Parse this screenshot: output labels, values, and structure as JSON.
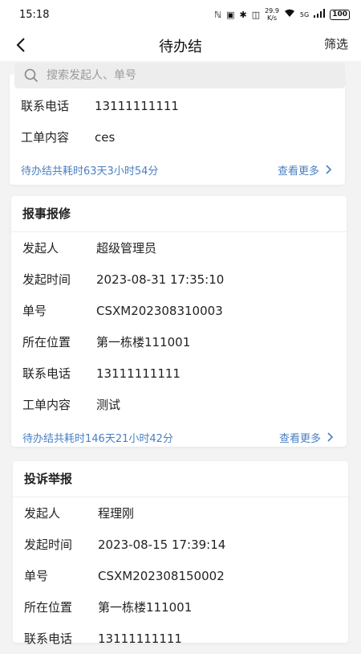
{
  "status_bar": {
    "time": "15:18",
    "net_speed_value": "29.9",
    "net_speed_unit": "K/s",
    "signal": "5G",
    "battery": "100"
  },
  "nav": {
    "title": "待办结",
    "filter_label": "筛选"
  },
  "search": {
    "placeholder": "搜索发起人、单号"
  },
  "colors": {
    "accent": "#4a7fc1",
    "background": "#f3f3f3"
  },
  "cards": [
    {
      "rows": [
        {
          "label": "联系电话",
          "value": "13111111111"
        },
        {
          "label": "工单内容",
          "value": "ces"
        }
      ],
      "elapsed": "待办结共耗时63天3小时54分",
      "more_label": "查看更多"
    },
    {
      "title": "报事报修",
      "rows": [
        {
          "label": "发起人",
          "value": "超级管理员"
        },
        {
          "label": "发起时间",
          "value": "2023-08-31 17:35:10"
        },
        {
          "label": "单号",
          "value": "CSXM202308310003"
        },
        {
          "label": "所在位置",
          "value": "第一栋楼111001"
        },
        {
          "label": "联系电话",
          "value": "13111111111"
        },
        {
          "label": "工单内容",
          "value": "测试"
        }
      ],
      "elapsed": "待办结共耗时146天21小时42分",
      "more_label": "查看更多"
    },
    {
      "title": "投诉举报",
      "rows": [
        {
          "label": "发起人",
          "value": "程理刚"
        },
        {
          "label": "发起时间",
          "value": "2023-08-15 17:39:14"
        },
        {
          "label": "单号",
          "value": "CSXM202308150002"
        },
        {
          "label": "所在位置",
          "value": "第一栋楼111001"
        },
        {
          "label": "联系电话",
          "value": "13111111111"
        }
      ]
    }
  ]
}
